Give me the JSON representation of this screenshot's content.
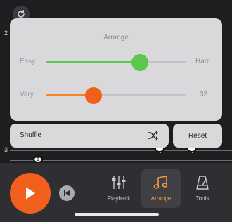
{
  "colors": {
    "accent_orange": "#f0601c",
    "easy_green": "#5cc84b",
    "vary_orange": "#f5832a",
    "active_tab_orange": "#f39a42"
  },
  "score": {
    "measure_top": "2",
    "measure_bottom": "3",
    "note_marker": "0"
  },
  "arrange_panel": {
    "title": "Arrange",
    "easy": {
      "label": "Easy",
      "end_label": "Hard",
      "value_fraction": 0.67
    },
    "vary": {
      "label": "Vary",
      "value_label": "32",
      "value_fraction": 0.34
    }
  },
  "buttons": {
    "shuffle": "Shuffle",
    "reset": "Reset"
  },
  "tabs": [
    {
      "label": "Playback",
      "icon": "sliders-icon"
    },
    {
      "label": "Arrange",
      "icon": "music-note-icon",
      "active": true
    },
    {
      "label": "Tools",
      "icon": "metronome-icon"
    }
  ]
}
